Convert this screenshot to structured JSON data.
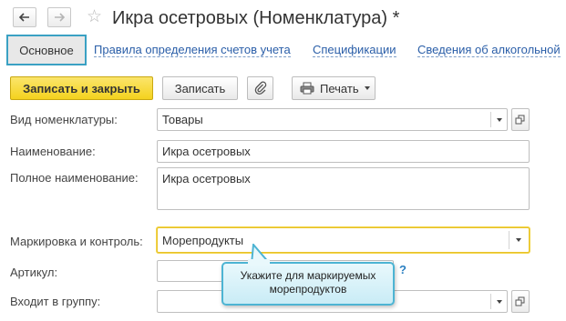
{
  "window": {
    "title": "Икра осетровых (Номенклатура) *"
  },
  "tabs": [
    {
      "label": "Основное",
      "active": true
    },
    {
      "label": "Правила определения счетов учета"
    },
    {
      "label": "Спецификации"
    },
    {
      "label": "Сведения об алкогольной"
    }
  ],
  "toolbar": {
    "save_close_label": "Записать и закрыть",
    "save_label": "Записать",
    "print_label": "Печать"
  },
  "form": {
    "nomenclature_type": {
      "label": "Вид номенклатуры:",
      "value": "Товары"
    },
    "name": {
      "label": "Наименование:",
      "value": "Икра осетровых"
    },
    "full_name": {
      "label": "Полное наименование:",
      "value": "Икра осетровых"
    },
    "marking": {
      "label": "Маркировка и контроль:",
      "value": "Морепродукты"
    },
    "article": {
      "label": "Артикул:",
      "value": ""
    },
    "group": {
      "label": "Входит в группу:",
      "value": ""
    },
    "help_mark": "?"
  },
  "tooltip": {
    "text": "Укажите для маркируемых морепродуктов"
  },
  "colors": {
    "primary_button": "#f4d21e",
    "tab_border": "#3aa1c3",
    "link": "#2a5ea8",
    "focus_border": "#e8c22a",
    "tooltip_border": "#4db4d3"
  },
  "icons": [
    "back-arrow-icon",
    "forward-arrow-icon",
    "favorite-star-icon",
    "paperclip-icon",
    "printer-icon",
    "chevron-down-icon",
    "open-window-icon"
  ]
}
